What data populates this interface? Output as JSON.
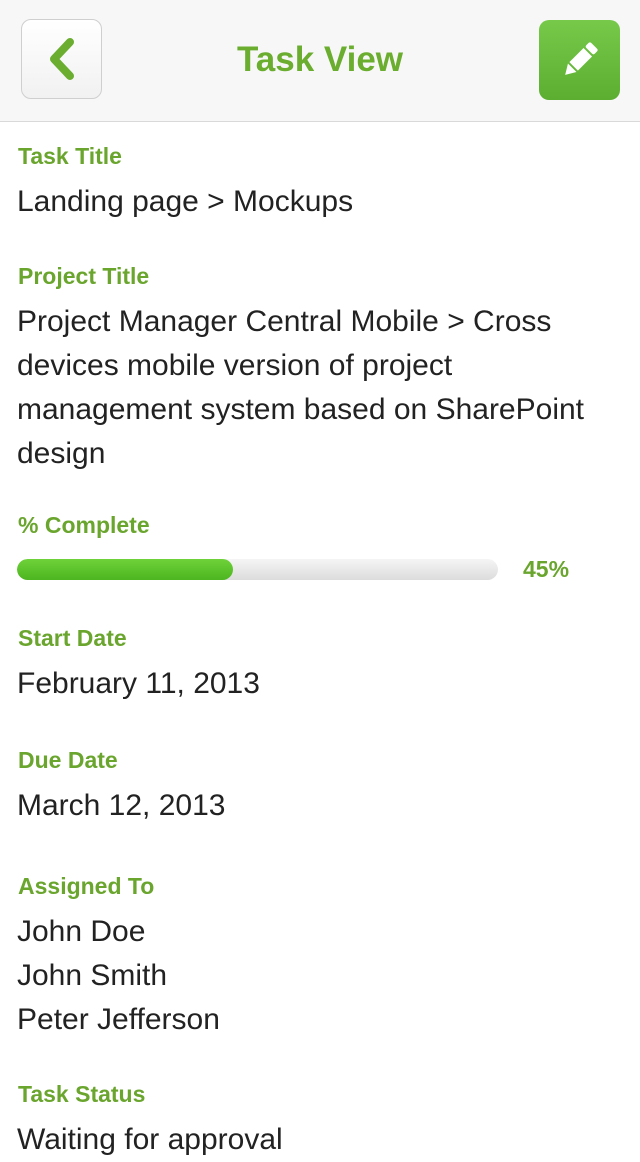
{
  "header": {
    "title": "Task View",
    "back_icon": "chevron-left-icon",
    "edit_icon": "pencil-icon",
    "accent_color": "#6aad2f"
  },
  "fields": {
    "task_title": {
      "label": "Task Title",
      "value": "Landing page > Mockups"
    },
    "project_title": {
      "label": "Project Title",
      "value": "Project Manager Central Mobile > Cross devices mobile version of project management system based on SharePoint design"
    },
    "percent_complete": {
      "label": "% Complete",
      "value": 45,
      "value_text": "45%"
    },
    "start_date": {
      "label": "Start Date",
      "value": "February 11, 2013"
    },
    "due_date": {
      "label": "Due Date",
      "value": "March 12, 2013"
    },
    "assigned_to": {
      "label": "Assigned To",
      "people": [
        "John Doe",
        "John Smith",
        "Peter Jefferson"
      ]
    },
    "task_status": {
      "label": "Task Status",
      "value": "Waiting for approval"
    }
  }
}
